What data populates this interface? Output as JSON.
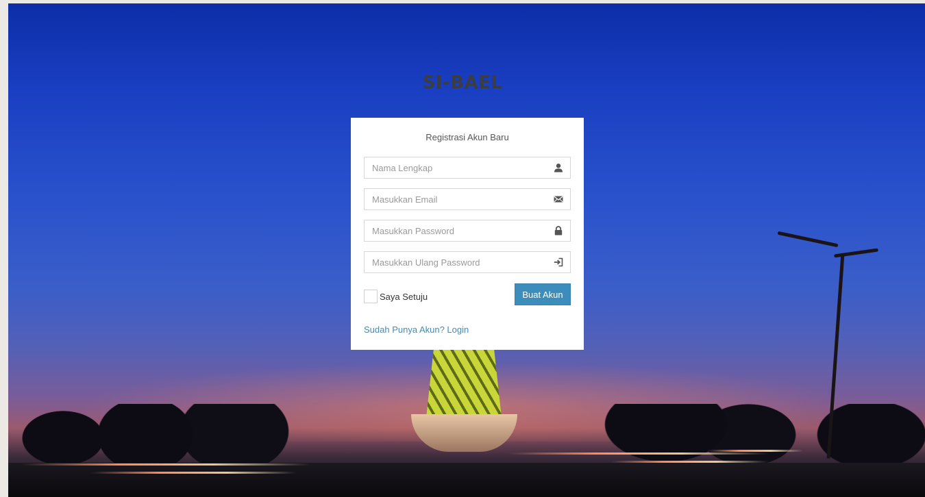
{
  "app": {
    "title": "SI-BAEL"
  },
  "register": {
    "heading": "Registrasi Akun Baru",
    "fields": [
      {
        "placeholder": "Nama Lengkap",
        "value": "",
        "icon": "user-icon"
      },
      {
        "placeholder": "Masukkan Email",
        "value": "",
        "icon": "envelope-icon"
      },
      {
        "placeholder": "Masukkan Password",
        "value": "",
        "icon": "lock-icon"
      },
      {
        "placeholder": "Masukkan Ulang Password",
        "value": "",
        "icon": "log-in-icon"
      }
    ],
    "agree_label": "Saya Setuju",
    "agree_checked": false,
    "submit_label": "Buat Akun",
    "login_link": "Sudah Punya Akun? Login"
  },
  "colors": {
    "primary": "#3c8dbc",
    "card": "#ffffff",
    "title": "#3a3c46"
  }
}
